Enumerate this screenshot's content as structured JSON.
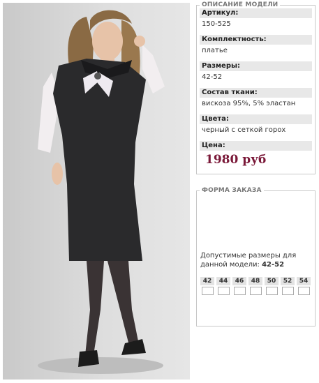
{
  "description": {
    "title": "ОПИСАНИЕ МОДЕЛИ",
    "fields": [
      {
        "label": "Артикул:",
        "value": "150-525"
      },
      {
        "label": "Комплектность:",
        "value": "платье"
      },
      {
        "label": "Размеры:",
        "value": "42-52"
      },
      {
        "label": "Состав ткани:",
        "value": "вискоза 95%, 5% эластан"
      },
      {
        "label": "Цвета:",
        "value": "черный с сеткой горох"
      }
    ],
    "price_label": "Цена:",
    "price_value": "1980 руб"
  },
  "order": {
    "title": "ФОРМА ЗАКАЗА",
    "allowed_text": "Допустимые размеры для данной модели:",
    "allowed_value": "42-52",
    "sizes": [
      "42",
      "44",
      "46",
      "48",
      "50",
      "52",
      "54"
    ]
  },
  "colors": {
    "price": "#7a1838",
    "label_bg": "#e8e8e8",
    "dress": "#2a2a2c",
    "background": "#d8d8d8"
  }
}
